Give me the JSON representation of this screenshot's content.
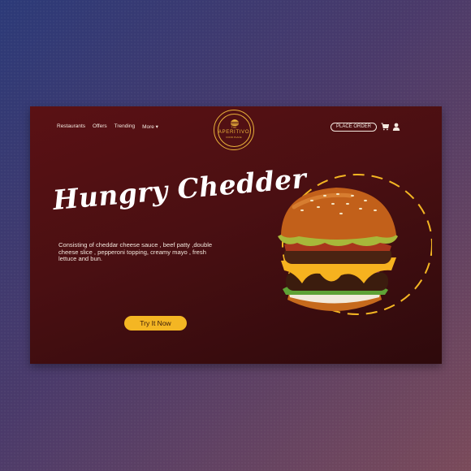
{
  "nav": {
    "items": [
      "Restaurants",
      "Offers",
      "Trending",
      "More ▾"
    ]
  },
  "logo": {
    "top": "THE",
    "name": "APERITIVO",
    "tagline": "FOOD PLACE"
  },
  "header": {
    "place_order_label": "PLACE ORDER"
  },
  "hero": {
    "title": "Hungry Chedder",
    "description": "Consisting of cheddar cheese sauce , beef patty ,double cheese slice , pepperoni topping, creamy mayo , fresh lettuce and bun.",
    "cta_label": "Try It Now"
  },
  "colors": {
    "accent": "#f4b623",
    "page_bg": "#4a0f12",
    "text_light": "#f4e9e0"
  },
  "icons": [
    "cart-icon",
    "user-icon",
    "burger-logo-icon"
  ]
}
